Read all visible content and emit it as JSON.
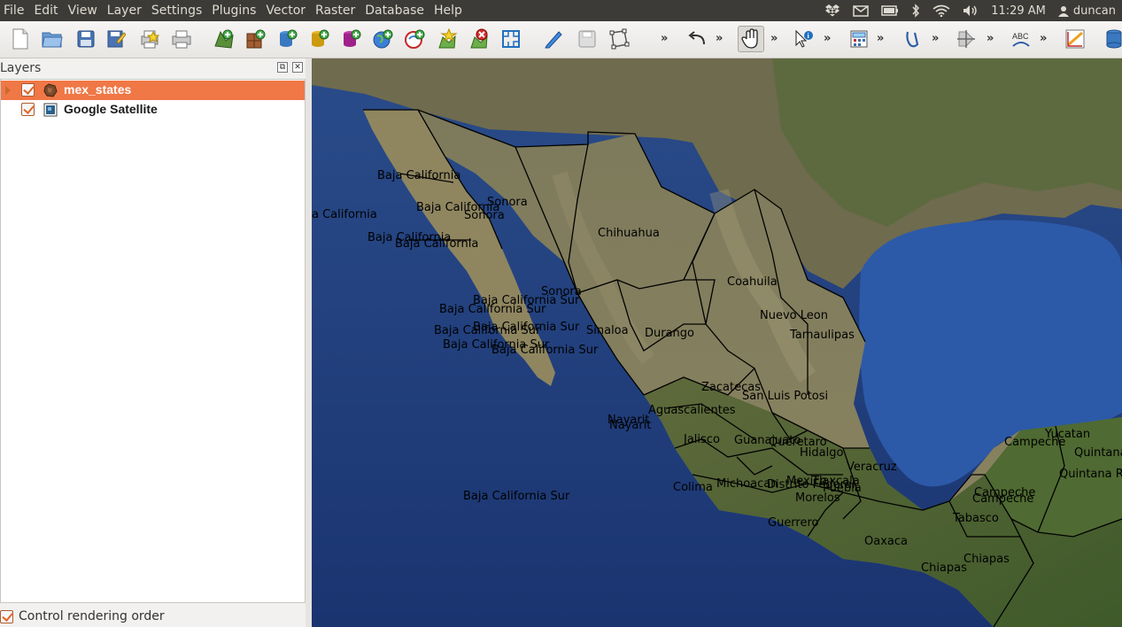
{
  "menubar": {
    "items": [
      "File",
      "Edit",
      "View",
      "Layer",
      "Settings",
      "Plugins",
      "Vector",
      "Raster",
      "Database",
      "Help"
    ],
    "clock": "11:29 AM",
    "user": "duncan"
  },
  "toolbar": {
    "buttons": [
      "new-project",
      "open-project",
      "save-project",
      "save-as",
      "new-print-composer",
      "print-composer-manager",
      "add-vector-layer",
      "add-raster-layer",
      "add-postgis-layer",
      "add-spatialite-layer",
      "add-mssql-layer",
      "add-wms-layer",
      "add-wcs-layer",
      "new-shapefile",
      "remove-layer",
      "add-wfs-layer",
      "toggle-editing",
      "save-edits",
      "digitize",
      "undo",
      "pan",
      "identify",
      "field-calculator",
      "text-annotation",
      "move-feature",
      "labeling",
      "spell-label",
      "measure",
      "db-manager"
    ],
    "overflow": "»"
  },
  "layers_panel": {
    "title": "Layers",
    "float_button": "⧉",
    "close_button": "✕",
    "layers": [
      {
        "name": "mex_states",
        "visible": true,
        "selected": true
      },
      {
        "name": "Google Satellite",
        "visible": true,
        "selected": false
      }
    ],
    "render_order_label": "Control rendering order",
    "render_order_checked": true
  },
  "map": {
    "labels": [
      "Baja California",
      "Sonora",
      "Baja California",
      "Sonora",
      "a California",
      "Baja California",
      "Baja California",
      "Chihuahua",
      "Sonora",
      "Baja California Sur",
      "Baja California Sur",
      "Coahuila",
      "Sinaloa",
      "Baja California Sur",
      "Baja California Sur",
      "Baja California Sur",
      "Baja California Sur",
      "Durango",
      "Nuevo Leon",
      "Tamaulipas",
      "Zacatecas",
      "San Luis Potosi",
      "Nayarit",
      "Nayarit",
      "Aguascalientes",
      "Jalisco",
      "Guanajuato",
      "Queretaro",
      "Hidalgo",
      "Veracruz",
      "Colima",
      "Michoacan",
      "Distrito Federal",
      "Mexico",
      "Tlaxcala",
      "Puebla",
      "Morelos",
      "Guerrero",
      "Oaxaca",
      "Tabasco",
      "Chiapas",
      "Chiapas",
      "Campeche",
      "Campeche",
      "Campeche",
      "Yucatan",
      "Quintana",
      "Quintana Roo",
      "Baja California Sur"
    ]
  },
  "colors": {
    "menubar": "#3c3b37",
    "selection": "#f07746",
    "ocean": "#1f3e7a",
    "land": "#6b6a4a"
  }
}
